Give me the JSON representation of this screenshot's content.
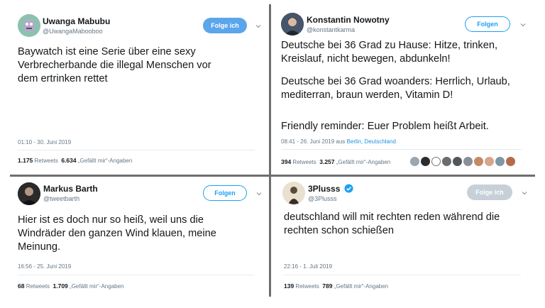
{
  "tweets": [
    {
      "name": "Uwanga Mabubu",
      "handle": "@UwangaMabooboo",
      "follow_label": "Folge ich",
      "text": "Baywatch ist eine Serie über eine sexy Verbrecherbande die illegal Menschen vor dem ertrinken rettet",
      "timestamp": "01:10 - 30. Juni 2019",
      "retweets": "1.175",
      "retweets_label": "Retweets",
      "likes": "6.634",
      "likes_label": "„Gefällt mir“-Angaben"
    },
    {
      "name": "Konstantin Nowotny",
      "handle": "@konstantkarma",
      "follow_label": "Folgen",
      "text_p1": "Deutsche bei 36 Grad zu Hause: Hitze, trinken, Kreislauf, nicht bewegen, abdunkeln!",
      "text_p2": "Deutsche bei 36 Grad woanders: Herrlich, Urlaub, mediterran, braun werden, Vitamin D!",
      "text_p3": "Friendly reminder: Euer Problem heißt Arbeit.",
      "timestamp": "08:41 - 26. Juni 2019 aus",
      "location": "Berlin, Deutschland",
      "retweets": "394",
      "retweets_label": "Retweets",
      "likes": "3.257",
      "likes_label": "„Gefällt mir“-Angaben"
    },
    {
      "name": "Markus Barth",
      "handle": "@tweetbarth",
      "follow_label": "Folgen",
      "text": "Hier ist es doch nur so heiß, weil uns die Windräder den ganzen Wind klauen, meine Meinung.",
      "timestamp": "16:56 - 25. Juni 2019",
      "retweets": "68",
      "retweets_label": "Retweets",
      "likes": "1.709",
      "likes_label": "„Gefällt mir“-Angaben"
    },
    {
      "name": "3Plusss",
      "handle": "@3Plusss",
      "follow_label": "Folge ich",
      "text": "deutschland will mit rechten reden während die rechten schon schießen",
      "timestamp": "22:16 - 1. Juli 2019",
      "retweets": "139",
      "retweets_label": "Retweets",
      "likes": "789",
      "likes_label": "„Gefällt mir“-Angaben"
    }
  ],
  "colors": {
    "accent": "#1da1f2",
    "follow_filled": "#5ba6ea",
    "follow_disabled": "#c7d0d8",
    "divider": "#6e6e6e",
    "verified": "#1da1f2"
  },
  "icons": [
    "avatar",
    "chevron-down-icon",
    "verified-badge-icon",
    "liker-avatar"
  ]
}
